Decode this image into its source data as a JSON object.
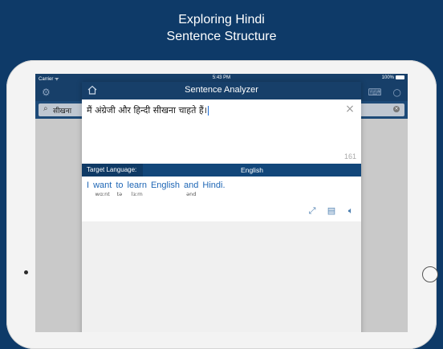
{
  "headline": {
    "line1": "Exploring Hindi",
    "line2": "Sentence Structure"
  },
  "status_bar": {
    "carrier": "Carrier ᯤ",
    "time": "5:43 PM",
    "battery": "100%"
  },
  "app": {
    "search_query": "सीखना",
    "search_clear_icon": "×"
  },
  "modal": {
    "title": "Sentence Analyzer",
    "input_text": "मैं अंग्रेजी और हिन्दी सीखना चाहते हैं।",
    "char_count": "161",
    "target_language_label": "Target Language:",
    "target_language_value": "English",
    "translation_words": [
      {
        "word": "I",
        "phonetic": ""
      },
      {
        "word": "want",
        "phonetic": "wɑːnt"
      },
      {
        "word": "to",
        "phonetic": "tə"
      },
      {
        "word": "learn",
        "phonetic": "lɜːrn"
      },
      {
        "word": "English",
        "phonetic": ""
      },
      {
        "word": "and",
        "phonetic": "ənd"
      },
      {
        "word": "Hindi.",
        "phonetic": ""
      }
    ],
    "icons": [
      "home-icon",
      "close-icon",
      "expand-icon",
      "document-icon",
      "speaker-icon"
    ]
  },
  "icons": [
    "gear-icon",
    "keyboard-icon",
    "search-icon",
    "magnifier-icon"
  ]
}
